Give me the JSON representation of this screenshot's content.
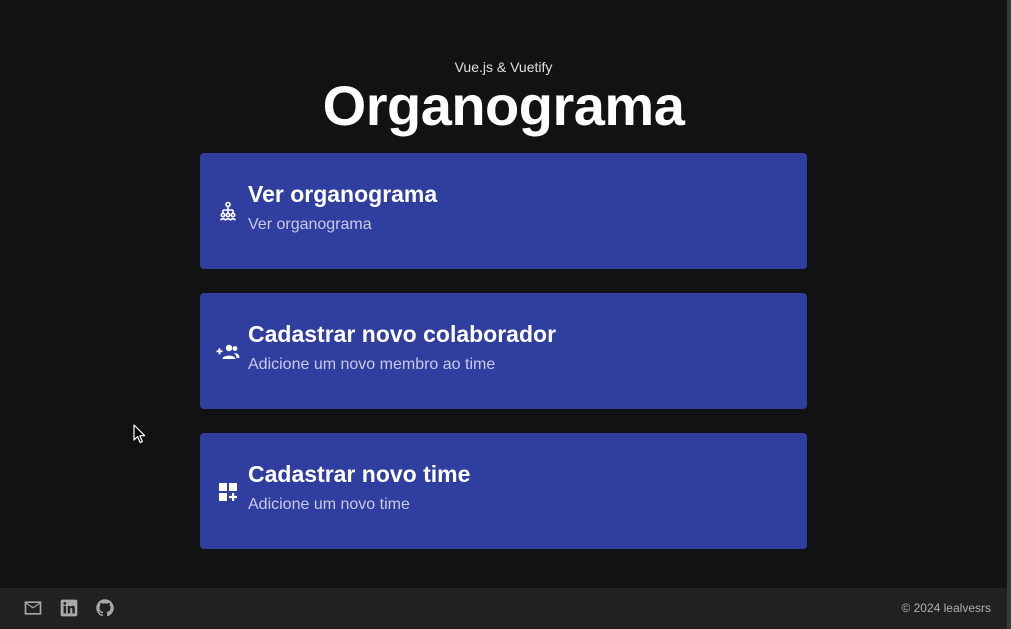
{
  "header": {
    "subtitle": "Vue.js & Vuetify",
    "title": "Organograma"
  },
  "cards": [
    {
      "icon": "org-chart-icon",
      "title": "Ver organograma",
      "subtitle": "Ver organograma"
    },
    {
      "icon": "add-user-group-icon",
      "title": "Cadastrar novo colaborador",
      "subtitle": "Adicione um novo membro ao time"
    },
    {
      "icon": "add-widget-icon",
      "title": "Cadastrar novo time",
      "subtitle": "Adicione um novo time"
    }
  ],
  "footer": {
    "icons": [
      "email-icon",
      "linkedin-icon",
      "github-icon"
    ],
    "copyright": "© 2024 lealvesrs"
  },
  "colors": {
    "background": "#121212",
    "card": "#303f9f",
    "footer": "#212121"
  }
}
